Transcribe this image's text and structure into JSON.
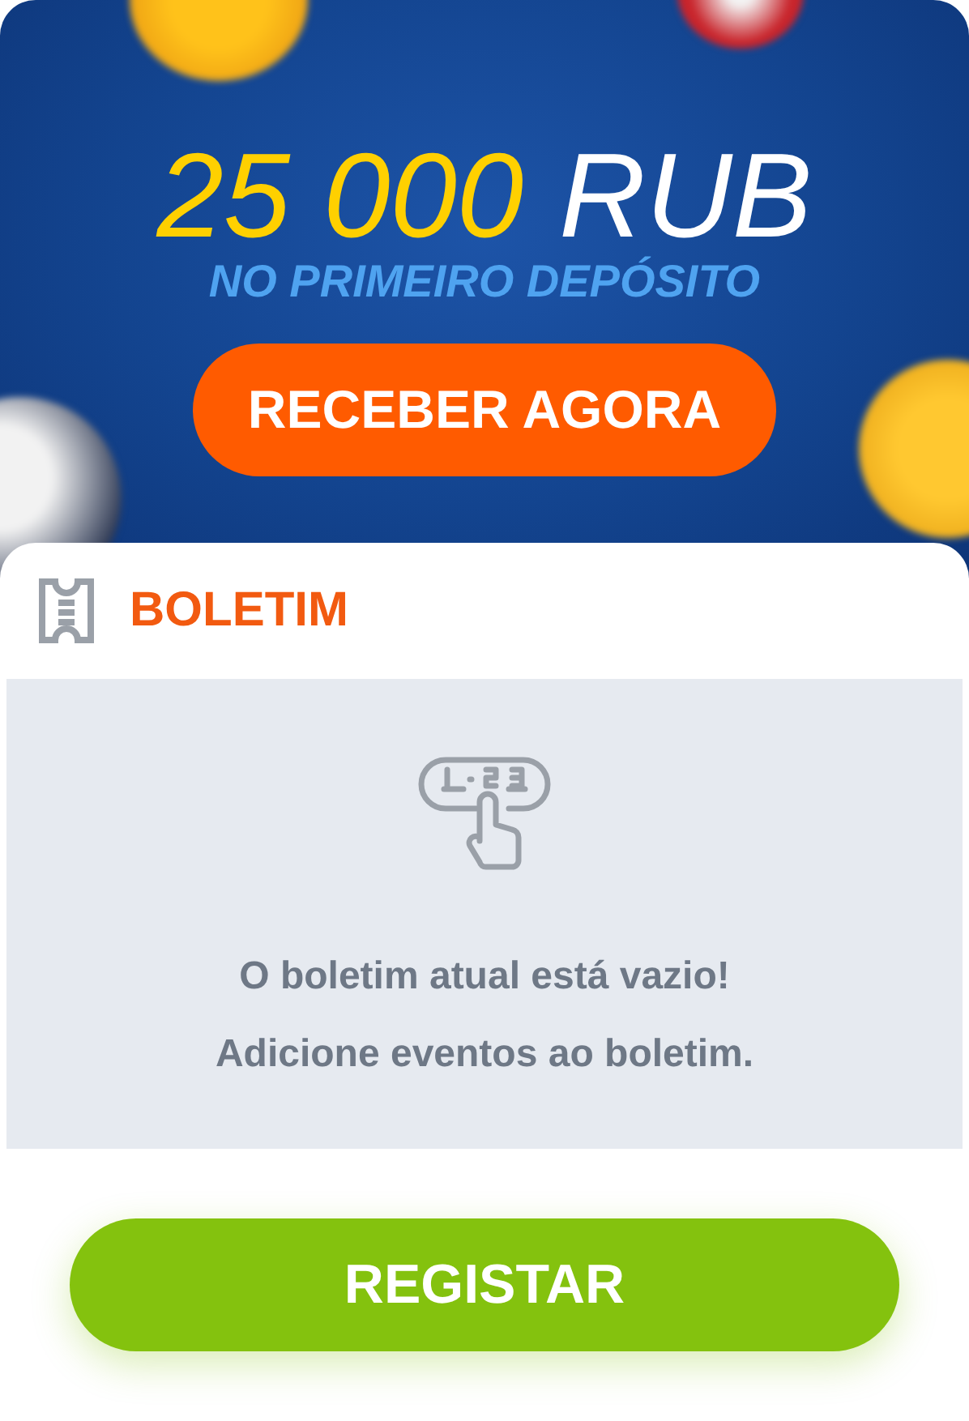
{
  "promo": {
    "amount": "25 000",
    "currency": "RUB",
    "subtitle": "NO PRIMEIRO DEPÓSITO",
    "button": "RECEBER AGORA"
  },
  "betslip": {
    "title": "BOLETIM",
    "empty_lines": [
      "O boletim atual está vazio!",
      "Adicione eventos ao boletim."
    ]
  },
  "register_button": "REGISTAR"
}
